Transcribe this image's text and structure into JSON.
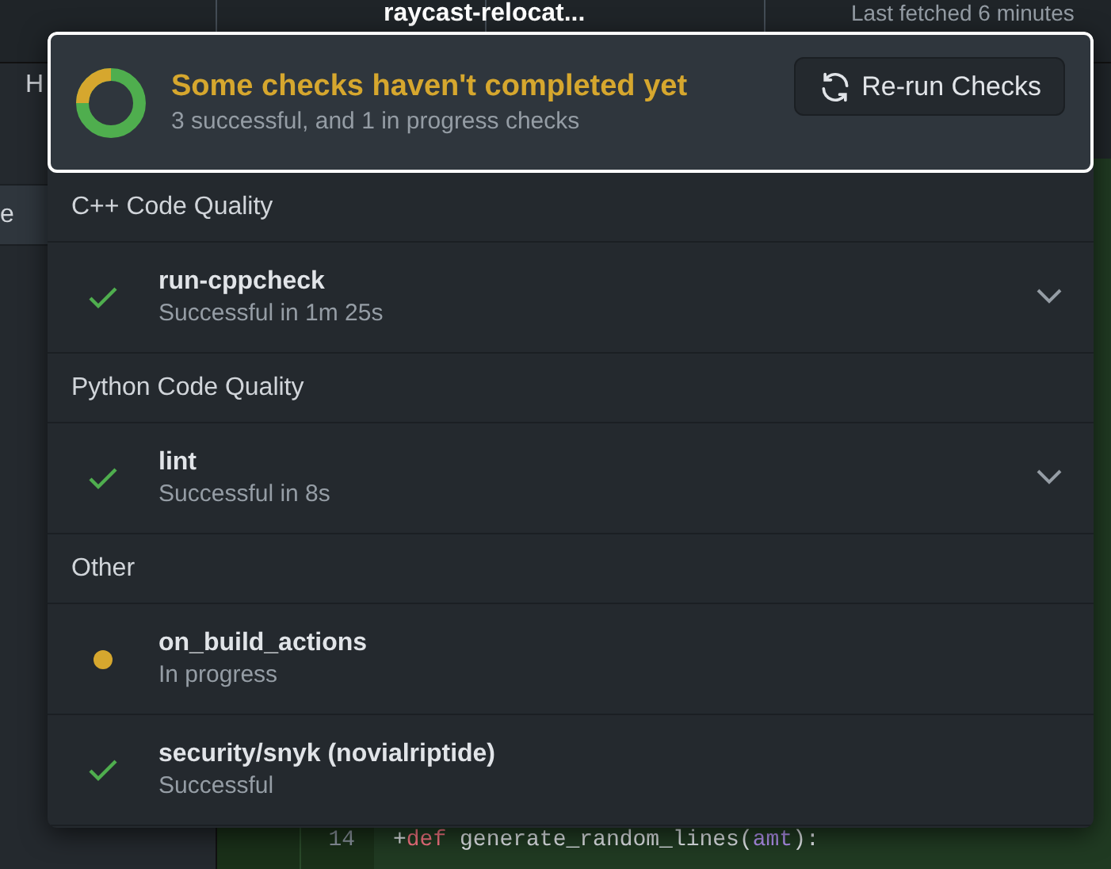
{
  "toolbar": {
    "branch": "raycast-relocat...",
    "fetch_status": "Last fetched 6 minutes"
  },
  "sidebar": {
    "items": [
      {
        "label": "H",
        "selected": false
      },
      {
        "label": "e",
        "selected": true
      }
    ]
  },
  "diff": {
    "lines": [
      {
        "number": "14",
        "sign": "+",
        "keyword": "def",
        "name": "generate_random_lines(",
        "param": "amt",
        "end": "):"
      }
    ]
  },
  "checks_popover": {
    "title": "Some checks haven't completed yet",
    "summary": "3 successful, and 1 in progress checks",
    "rerun_button": "Re-run Checks",
    "groups": [
      {
        "title": "C++ Code Quality",
        "checks": [
          {
            "name": "run-cppcheck",
            "detail": "Successful in 1m 25s",
            "kind": "success",
            "expandable": true
          }
        ]
      },
      {
        "title": "Python Code Quality",
        "checks": [
          {
            "name": "lint",
            "detail": "Successful in 8s",
            "kind": "success",
            "expandable": true
          }
        ]
      },
      {
        "title": "Other",
        "checks": [
          {
            "name": "on_build_actions",
            "detail": "In progress",
            "kind": "pending",
            "expandable": false
          },
          {
            "name": "security/snyk (novialriptide)",
            "detail": "Successful",
            "kind": "success",
            "expandable": false
          }
        ]
      }
    ]
  }
}
